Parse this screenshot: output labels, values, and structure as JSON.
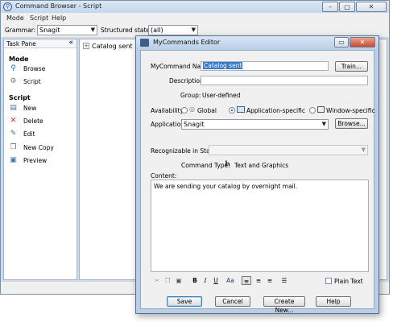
{
  "window": {
    "title": "Command Browser - Script"
  },
  "menu": [
    "Mode",
    "Script",
    "Help"
  ],
  "toolbar": {
    "grammar_label": "Grammar:",
    "grammar_value": "Snagit",
    "state_label": "Structured state:",
    "state_value": "(all)"
  },
  "task_pane": {
    "title": "Task Pane",
    "collapse": "«",
    "mode_section": "Mode",
    "mode_items": [
      "Browse",
      "Script"
    ],
    "script_section": "Script",
    "script_items": [
      "New",
      "Delete",
      "Edit",
      "New Copy",
      "Preview"
    ]
  },
  "tree": {
    "expander": "+",
    "item": "Catalog sent"
  },
  "dialog": {
    "title": "MyCommands Editor",
    "name_label": "MyCommand Name:",
    "name_value": "Catalog sent",
    "train_button": "Train...",
    "description_label": "Description:",
    "description_value": "",
    "group_label": "Group:",
    "group_value": "User-defined",
    "availability_label": "Availability:",
    "availability_options": [
      "Global",
      "Application-specific",
      "Window-specific"
    ],
    "availability_selected": "Application-specific",
    "application_label": "Application:",
    "application_value": "Snagit",
    "browse_button": "Browse...",
    "states_label": "Recognizable in States:",
    "command_type_label": "Command Type:",
    "command_type_value": "Text and Graphics",
    "content_label": "Content:",
    "content_text": "We are sending your catalog by overnight mail.",
    "format_toolbar": [
      "B",
      "I",
      "U",
      "Aa"
    ],
    "plain_text_label": "Plain Text",
    "buttons": {
      "save": "Save",
      "cancel": "Cancel",
      "create_new": "Create New...",
      "help": "Help"
    }
  }
}
